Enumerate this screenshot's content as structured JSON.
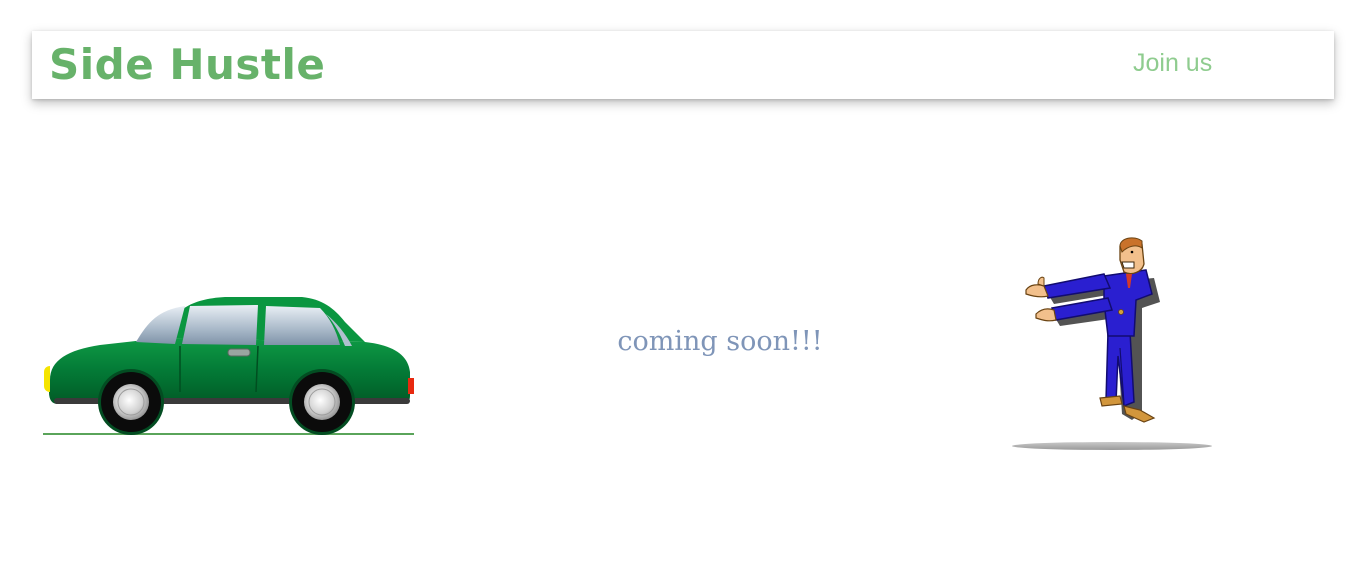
{
  "navbar": {
    "brand": "Side Hustle",
    "join_label": "Join us"
  },
  "main": {
    "message": "coming soon!!!"
  },
  "illustrations": {
    "left": "car-image",
    "right": "presenting-man-image"
  },
  "colors": {
    "brand": "#67b26a",
    "join_link": "#8fcc8f",
    "message": "#7f95b8",
    "car_body": "#036b2f",
    "suit": "#2a1fd0"
  }
}
